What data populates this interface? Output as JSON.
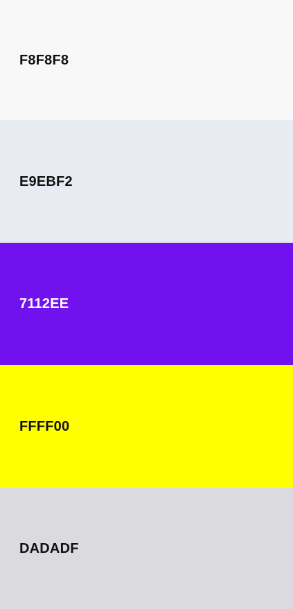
{
  "swatches": [
    {
      "label": "F8F8F8",
      "color": "#F8F8F8",
      "text_color": "#111111"
    },
    {
      "label": "E9EBF2",
      "color": "#E9EBF2",
      "text_color": "#111111"
    },
    {
      "label": "7112EE",
      "color": "#7112EE",
      "text_color": "#FFFFFF"
    },
    {
      "label": "FFFF00",
      "color": "#FFFF00",
      "text_color": "#111111"
    },
    {
      "label": "DADADF",
      "color": "#DADADF",
      "text_color": "#111111"
    }
  ]
}
